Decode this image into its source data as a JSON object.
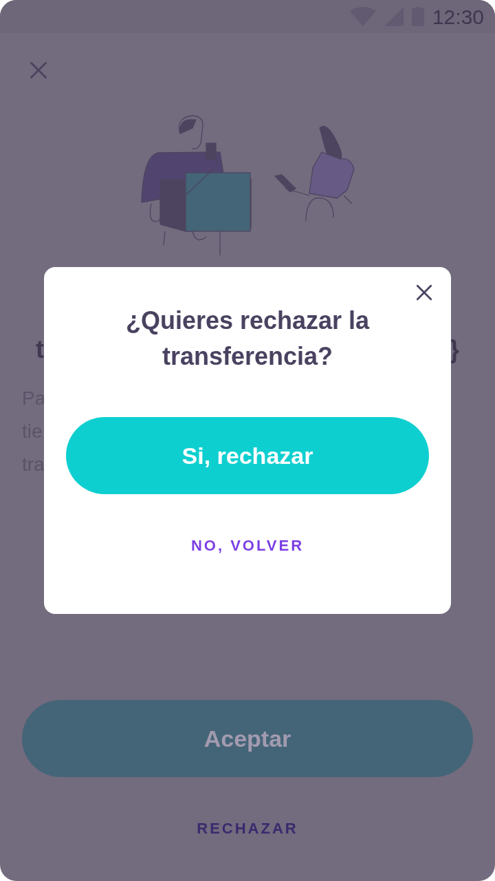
{
  "status_bar": {
    "time": "12:30"
  },
  "background": {
    "heading_fragments": [
      "t",
      "}"
    ],
    "body_fragments": [
      "Pa",
      "tie",
      "tra"
    ],
    "accept_button": {
      "label": "Aceptar",
      "disabled": true
    },
    "reject_link": "RECHAZAR"
  },
  "dialog": {
    "title": "¿Quieres rechazar la transferencia?",
    "confirm_button": "Si, rechazar",
    "cancel_link": "NO, VOLVER"
  }
}
